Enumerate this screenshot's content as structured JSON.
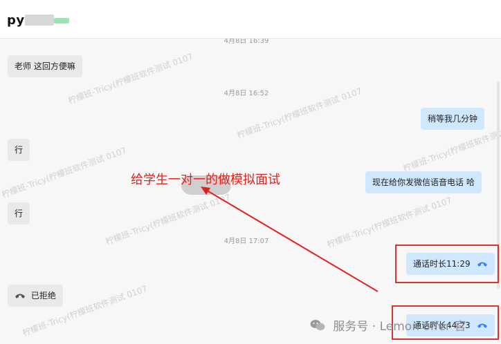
{
  "header": {
    "contact_name": "py"
  },
  "messages": [
    {
      "kind": "timestamp",
      "text": "4月8日 16:39"
    },
    {
      "kind": "incoming",
      "text": "老师 这回方便嘛"
    },
    {
      "kind": "timestamp",
      "text": "4月8日 16:52"
    },
    {
      "kind": "outgoing",
      "text": "稍等我几分钟"
    },
    {
      "kind": "incoming",
      "text": "行"
    },
    {
      "kind": "outgoing",
      "text": "现在给你发微信语音电话 哈"
    },
    {
      "kind": "incoming",
      "text": "行"
    },
    {
      "kind": "timestamp",
      "text": "4月8日 17:07"
    },
    {
      "kind": "outgoing",
      "text": "通话时长11:29",
      "icon": "phone-icon"
    },
    {
      "kind": "incoming",
      "text": "已拒绝",
      "icon": "phone-declined-icon"
    },
    {
      "kind": "outgoing",
      "text": "通话时长44:23",
      "icon": "phone-icon"
    }
  ],
  "annotation": {
    "text": "给学生一对一的做模拟面试",
    "color": "#e3201b"
  },
  "watermark": {
    "text": "柠檬班-Tricy(柠檬班软件测试 0107"
  },
  "footer": {
    "text": "服务号 · Lemon offer 官"
  },
  "colors": {
    "outgoing_bubble": "#cfe8ff",
    "incoming_bubble": "#e9e9e9",
    "highlight": "#e0302a",
    "call_icon": "#3b82f6"
  }
}
